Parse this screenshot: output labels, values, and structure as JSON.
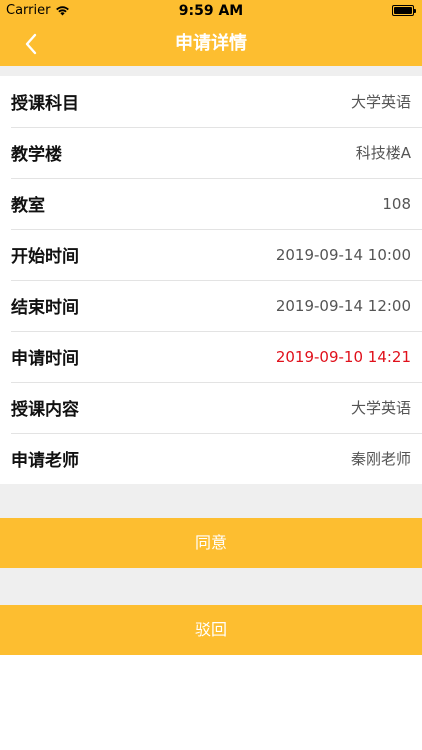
{
  "status_bar": {
    "carrier": "Carrier",
    "time": "9:59 AM"
  },
  "nav": {
    "title": "申请详情",
    "back_icon": "chevron-left-icon"
  },
  "details": [
    {
      "label": "授课科目",
      "value": "大学英语"
    },
    {
      "label": "教学楼",
      "value": "科技楼A"
    },
    {
      "label": "教室",
      "value": "108"
    },
    {
      "label": "开始时间",
      "value": "2019-09-14 10:00"
    },
    {
      "label": "结束时间",
      "value": "2019-09-14 12:00"
    },
    {
      "label": "申请时间",
      "value": "2019-09-10 14:21"
    },
    {
      "label": "授课内容",
      "value": "大学英语"
    },
    {
      "label": "申请老师",
      "value": "秦刚老师"
    }
  ],
  "actions": {
    "agree_label": "同意",
    "reject_label": "驳回"
  },
  "colors": {
    "accent": "#fdbe30",
    "highlight": "#e0101b",
    "background": "#efefef"
  }
}
